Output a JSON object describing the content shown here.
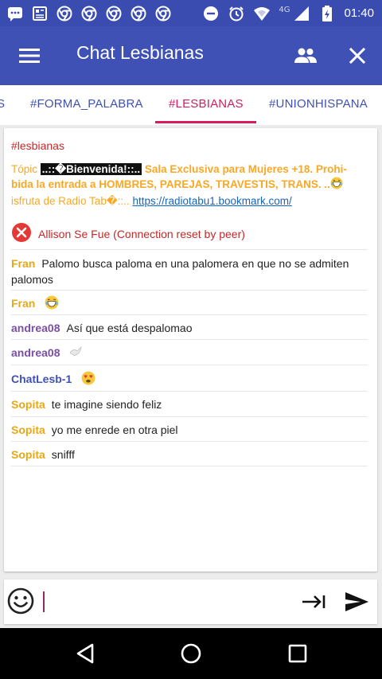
{
  "status": {
    "time": "01:40",
    "network": "4G"
  },
  "appbar": {
    "title": "Chat Lesbianas"
  },
  "tabs": [
    {
      "label": "S"
    },
    {
      "label": "#FORMA_PALABRA"
    },
    {
      "label": "#LESBIANAS"
    },
    {
      "label": "#UNIONHISPANA"
    }
  ],
  "chat": {
    "channel": "#lesbianas",
    "topic": {
      "prefix": "Tópic ",
      "highlight": "..::�Bienvenida!::..",
      "text": " Sala Exclusiva para Mujeres +18. Prohi-bida la entrada a HOMBRES, PAREJAS, TRAVESTIS, TRANS. ..",
      "suffix": "isfruta de Radio Tab�::.. ",
      "link": "https://radiotabu1.bookmark.com/"
    },
    "system_message": "Allison Se Fue (Connection reset by peer)",
    "messages": [
      {
        "nick": "Fran",
        "text": "Palomo busca paloma en una palomera en que no se admiten palomos"
      },
      {
        "nick": "Fran",
        "text": ""
      },
      {
        "nick": "andrea08",
        "text": "Así que está despalomao"
      },
      {
        "nick": "andrea08",
        "text": ""
      },
      {
        "nick": "ChatLesb-1",
        "text": ""
      },
      {
        "nick": "Sopita",
        "text": "te imagine siendo feliz"
      },
      {
        "nick": "Sopita",
        "text": "yo me enrede en otra piel"
      },
      {
        "nick": "Sopita",
        "text": "snifff"
      }
    ]
  },
  "input": {
    "value": ""
  },
  "colors": {
    "primary": "#3f51b5",
    "accent": "#d81b60",
    "topic": "#f9a825",
    "error": "#c62828",
    "nick_fran": "#e6a817",
    "nick_andrea": "#7b4fa8",
    "nick_chatlesb": "#3f51b5",
    "nick_sopita": "#e6a817"
  }
}
